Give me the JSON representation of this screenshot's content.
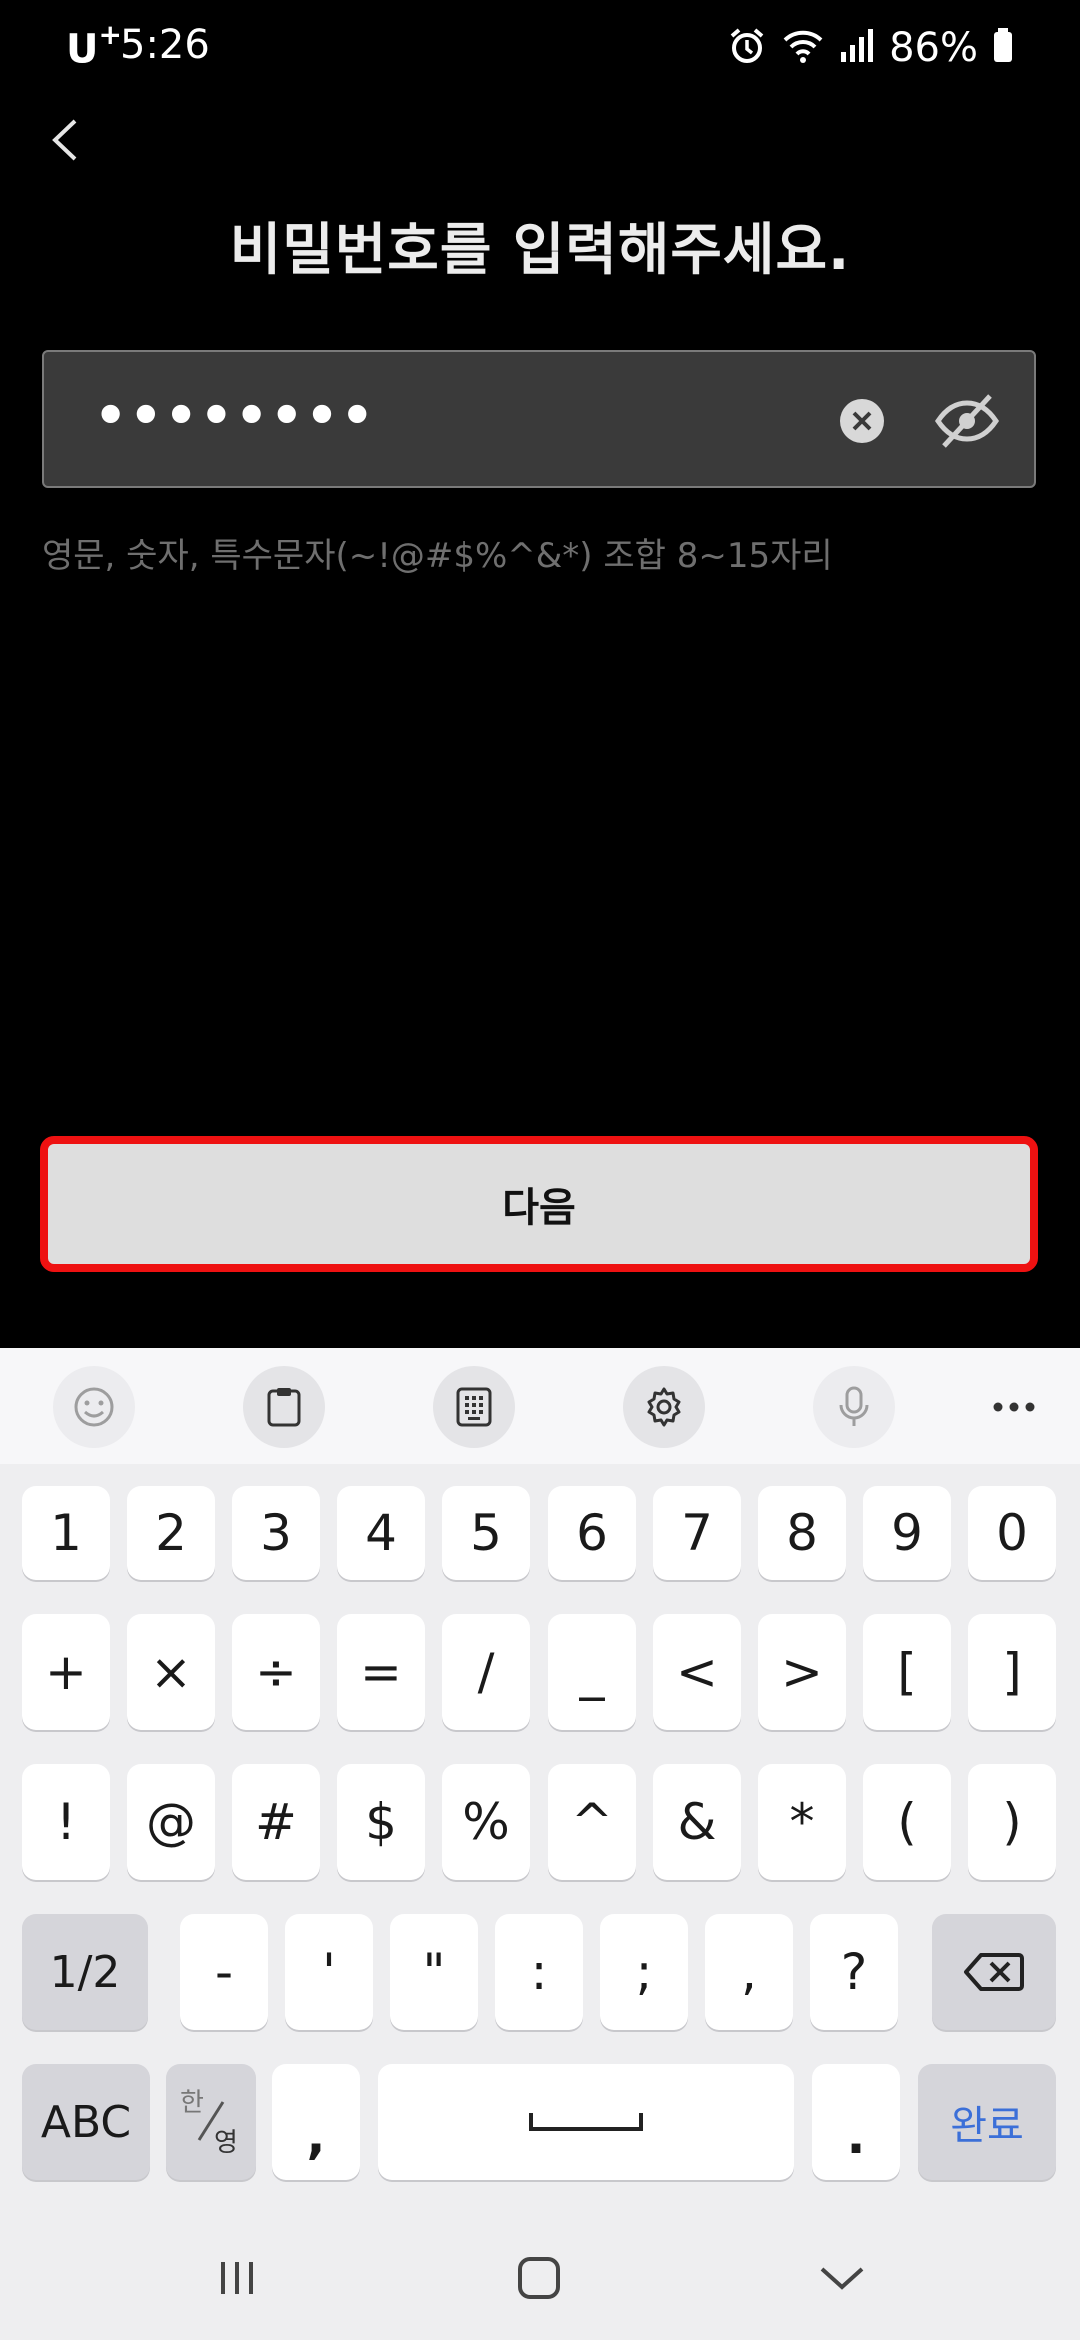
{
  "status_bar": {
    "carrier": "U",
    "carrier_sup": "+",
    "time": "5:26",
    "battery": "86%"
  },
  "header": {
    "title": "비밀번호를 입력해주세요."
  },
  "password": {
    "masked_value": "••••••••"
  },
  "hint": "영문, 숫자, 특수문자(~!@#$%^&*) 조합 8~15자리",
  "next_button": {
    "label": "다음"
  },
  "keyboard": {
    "row1": [
      "1",
      "2",
      "3",
      "4",
      "5",
      "6",
      "7",
      "8",
      "9",
      "0"
    ],
    "row2": [
      "+",
      "×",
      "÷",
      "=",
      "/",
      "_",
      "<",
      ">",
      "[",
      "]"
    ],
    "row3": [
      "!",
      "@",
      "#",
      "$",
      "%",
      "^",
      "&",
      "*",
      "(",
      ")"
    ],
    "row4": [
      "-",
      "'",
      "\"",
      ":",
      ";",
      ",",
      "?"
    ],
    "page_toggle": "1/2",
    "abc": "ABC",
    "lang_top": "한",
    "lang_bottom": "영",
    "comma": ",",
    "period": ".",
    "done": "완료"
  },
  "colors": {
    "accent_border": "#ee1111",
    "done_text": "#3b6fd8"
  }
}
